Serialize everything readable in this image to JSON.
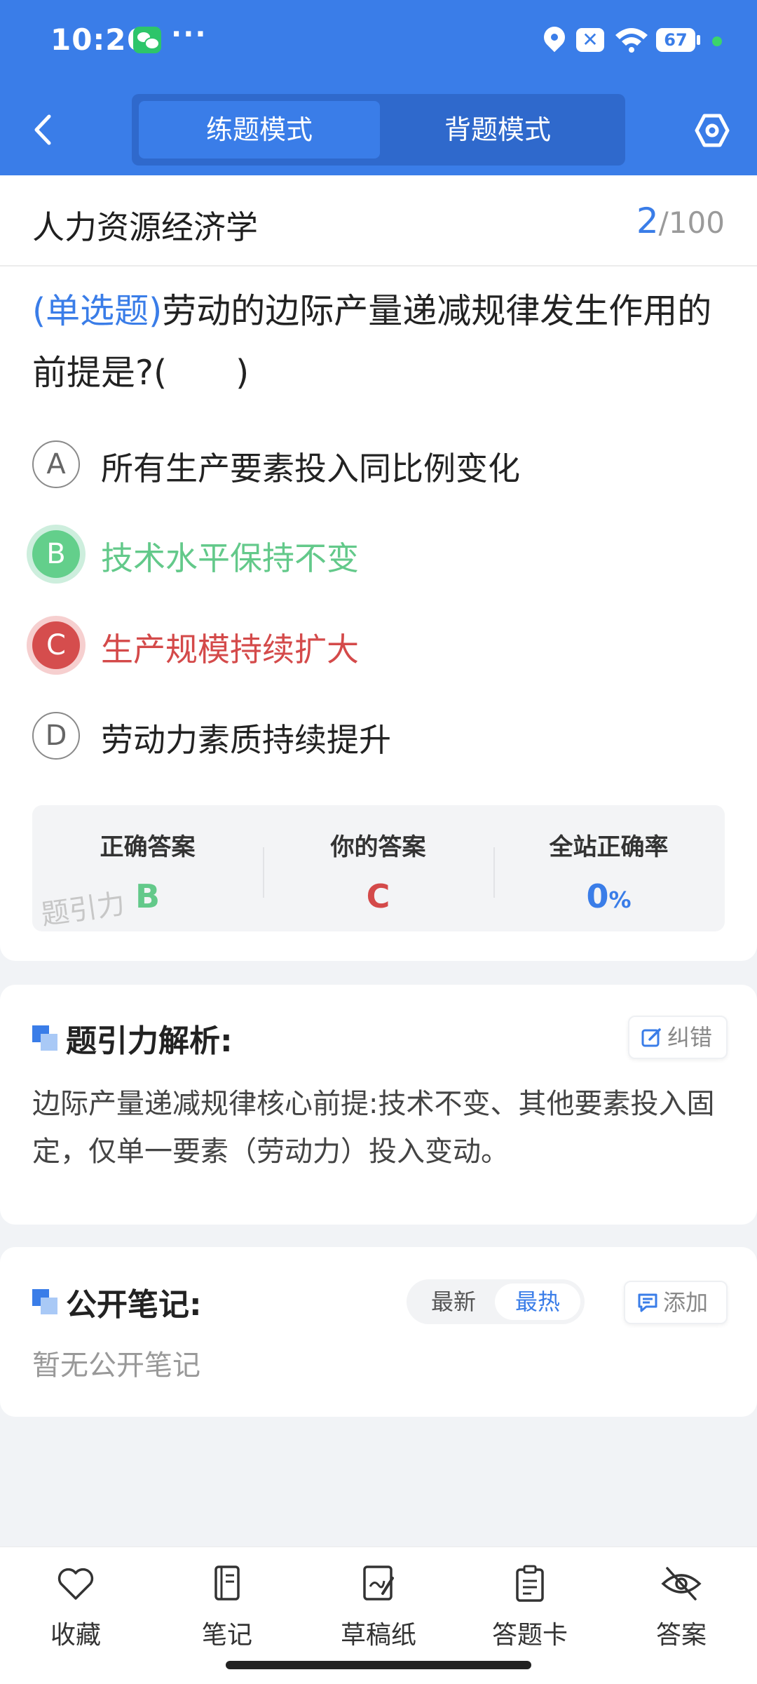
{
  "status_bar": {
    "time": "10:26",
    "more": "···",
    "battery": "67"
  },
  "nav": {
    "modes": [
      "练题模式",
      "背题模式"
    ],
    "active_mode": "练题模式"
  },
  "subject": {
    "title": "人力资源经济学",
    "current": "2",
    "total": "/100"
  },
  "question": {
    "type": "(单选题)",
    "text": "劳动的边际产量递减规律发生作用的前提是?(　　)",
    "options": [
      {
        "letter": "A",
        "text": "所有生产要素投入同比例变化",
        "state": "normal"
      },
      {
        "letter": "B",
        "text": "技术水平保持不变",
        "state": "correct"
      },
      {
        "letter": "C",
        "text": "生产规模持续扩大",
        "state": "wrong"
      },
      {
        "letter": "D",
        "text": "劳动力素质持续提升",
        "state": "normal"
      }
    ]
  },
  "answer_summary": {
    "correct_label": "正确答案",
    "correct_value": "B",
    "yours_label": "你的答案",
    "yours_value": "C",
    "rate_label": "全站正确率",
    "rate_value": "0",
    "rate_unit": "%",
    "watermark": "题引力"
  },
  "analysis": {
    "title": "题引力解析:",
    "report_label": "纠错",
    "text": "边际产量递减规律核心前提:技术不变、其他要素投入固定，仅单一要素（劳动力）投入变动。"
  },
  "notes": {
    "title": "公开笔记:",
    "sort_options": [
      "最新",
      "最热"
    ],
    "active_sort": "最热",
    "add_label": "添加",
    "empty_text": "暂无公开笔记"
  },
  "bottom_tabs": [
    {
      "label": "收藏",
      "icon": "heart-icon"
    },
    {
      "label": "笔记",
      "icon": "notebook-icon"
    },
    {
      "label": "草稿纸",
      "icon": "draft-icon"
    },
    {
      "label": "答题卡",
      "icon": "clipboard-icon"
    },
    {
      "label": "答案",
      "icon": "eye-off-icon"
    }
  ],
  "colors": {
    "primary": "#3a7de8",
    "correct": "#63cf8b",
    "wrong": "#d54d4d"
  }
}
